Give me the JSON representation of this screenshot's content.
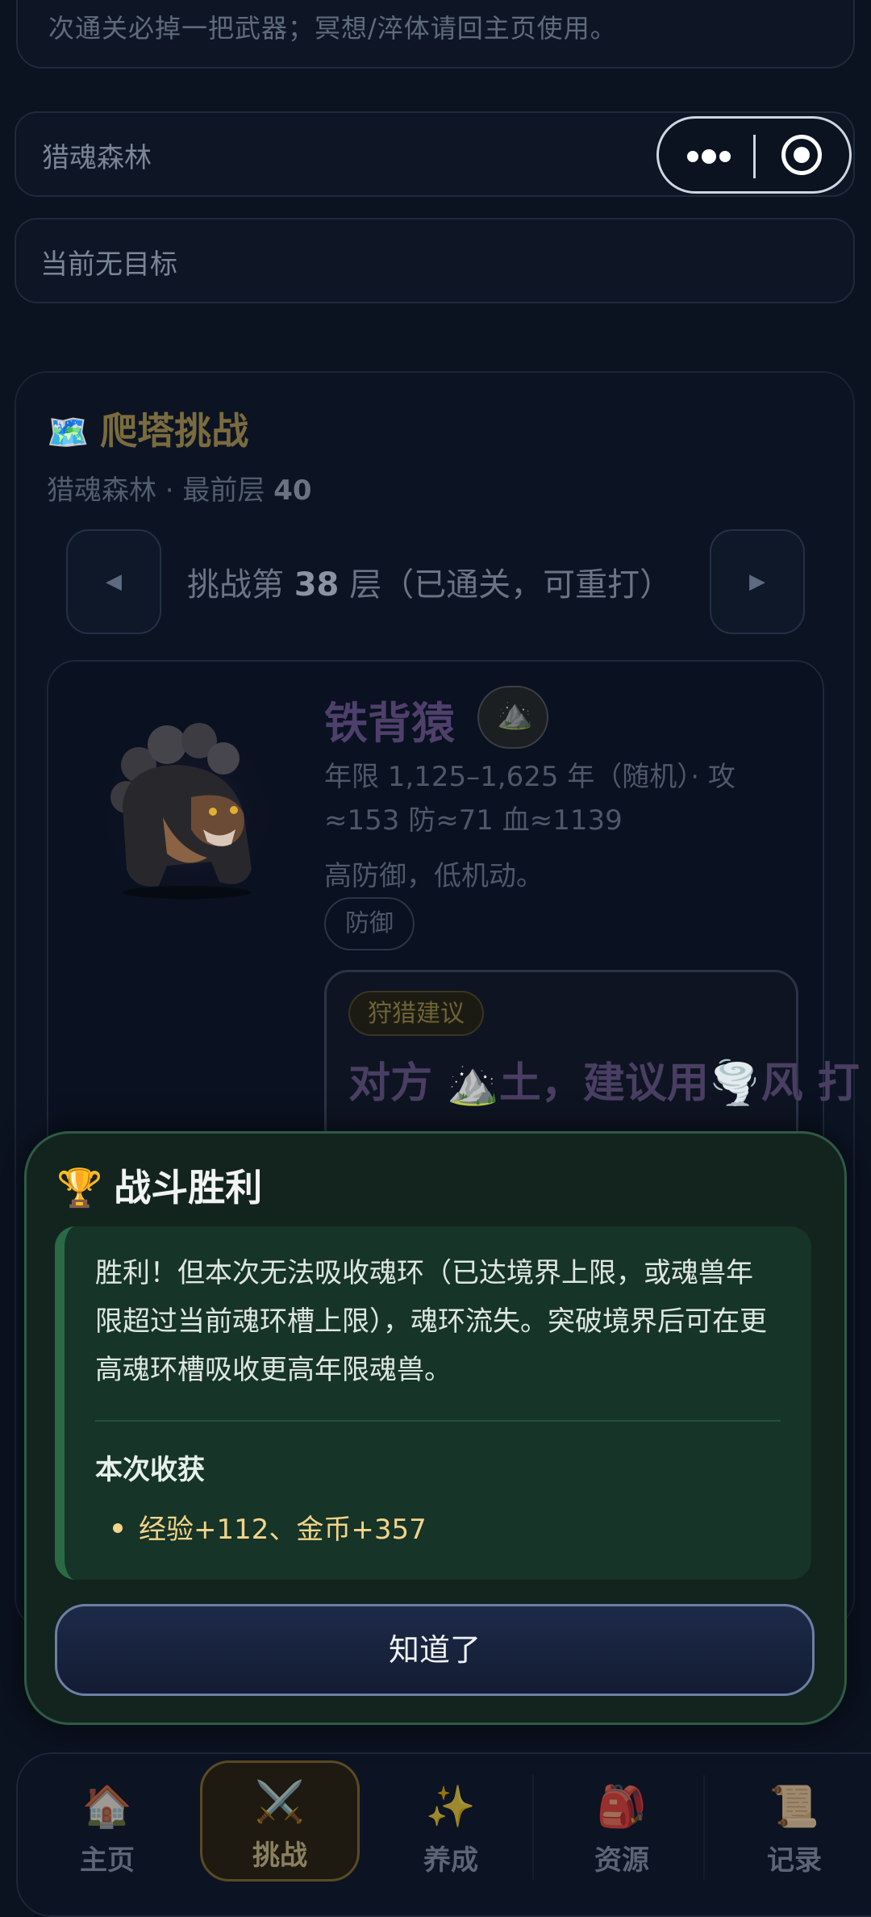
{
  "notice": {
    "text": "次通关必掉一把武器；冥想/淬体请回主页使用。"
  },
  "location_bar": {
    "label": "猎魂森林"
  },
  "target_bar": {
    "label": "当前无目标"
  },
  "capsule": {
    "more_icon": "more-dots-icon",
    "close_icon": "target-icon"
  },
  "tower": {
    "icon": "🗺️",
    "title": "爬塔挑战",
    "subtitle_prefix": "猎魂森林 · 最前层 ",
    "max_floor": "40",
    "prev_label": "◀",
    "next_label": "▶",
    "floor_prefix": "挑战第 ",
    "floor_number": "38",
    "floor_suffix": " 层（已通关，可重打）"
  },
  "beast": {
    "name": "铁背猿",
    "element_icon": "⛰️",
    "info": "年限 1,125–1,625 年（随机）· 攻≈153 防≈71 血≈1139",
    "desc": "高防御，低机动。",
    "tag": "防御",
    "hint_badge": "狩猎建议",
    "hint_text": "对方 ⛰️土，建议用🌪️风 打"
  },
  "modal": {
    "icon": "🏆",
    "title": "战斗胜利",
    "message": "胜利！但本次无法吸收魂环（已达境界上限，或魂兽年限超过当前魂环槽上限），魂环流失。突破境界后可在更高魂环槽吸收更高年限魂兽。",
    "gain_title": "本次收获",
    "gain_items": [
      "经验+112、金币+357"
    ],
    "ok_label": "知道了"
  },
  "bottom_nav": {
    "items": [
      {
        "icon": "🏠",
        "label": "主页"
      },
      {
        "icon": "⚔️",
        "label": "挑战"
      },
      {
        "icon": "✨",
        "label": "养成"
      },
      {
        "icon": "🎒",
        "label": "资源"
      },
      {
        "icon": "📜",
        "label": "记录"
      }
    ],
    "active_index": 1
  }
}
